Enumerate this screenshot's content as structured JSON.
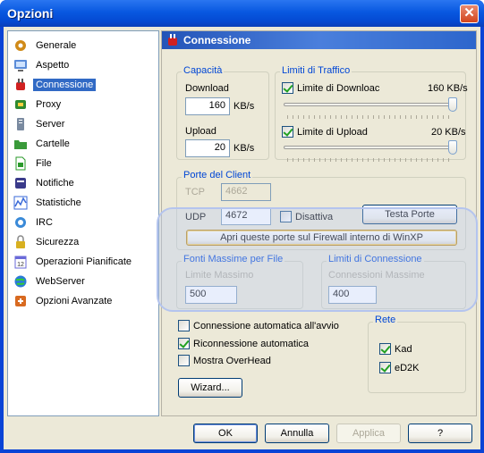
{
  "window": {
    "title": "Opzioni",
    "close_glyph": "✕"
  },
  "sidebar": {
    "items": [
      {
        "label": "Generale",
        "icon": "gear-icon",
        "color": "#d08a18"
      },
      {
        "label": "Aspetto",
        "icon": "monitor-icon",
        "color": "#5b8cd8"
      },
      {
        "label": "Connessione",
        "icon": "plug-icon",
        "color": "#d02020",
        "selected": true
      },
      {
        "label": "Proxy",
        "icon": "proxy-icon",
        "color": "#2f8a2f"
      },
      {
        "label": "Server",
        "icon": "server-icon",
        "color": "#7a8aa0"
      },
      {
        "label": "Cartelle",
        "icon": "folder-icon",
        "color": "#3a9a3a"
      },
      {
        "label": "File",
        "icon": "file-icon",
        "color": "#2a9a2a"
      },
      {
        "label": "Notifiche",
        "icon": "notification-icon",
        "color": "#3a3a8a"
      },
      {
        "label": "Statistiche",
        "icon": "chart-icon",
        "color": "#3a6ad8"
      },
      {
        "label": "IRC",
        "icon": "irc-icon",
        "color": "#3a8ad8"
      },
      {
        "label": "Sicurezza",
        "icon": "lock-icon",
        "color": "#d8b020"
      },
      {
        "label": "Operazioni Pianificate",
        "icon": "calendar-icon",
        "color": "#6a6ad8"
      },
      {
        "label": "WebServer",
        "icon": "globe-icon",
        "color": "#2a7ad8"
      },
      {
        "label": "Opzioni Avanzate",
        "icon": "advanced-icon",
        "color": "#d86a20"
      }
    ]
  },
  "panel": {
    "title": "Connessione",
    "capacita": {
      "title": "Capacità",
      "download_label": "Download",
      "download_value": "160",
      "download_unit": "KB/s",
      "upload_label": "Upload",
      "upload_value": "20",
      "upload_unit": "KB/s"
    },
    "limiti": {
      "title": "Limiti di Traffico",
      "download_check": "Limite di Downloac",
      "download_checked": true,
      "download_value": "160 KB/s",
      "download_level": 1.0,
      "upload_check": "Limite di Upload",
      "upload_checked": true,
      "upload_value": "20 KB/s",
      "upload_level": 1.0
    },
    "porte": {
      "title": "Porte del Client",
      "tcp_label": "TCP",
      "tcp_value": "4662",
      "udp_label": "UDP",
      "udp_value": "4672",
      "disattiva_label": "Disattiva",
      "disattiva_checked": false,
      "testa_label": "Testa Porte",
      "firewall_label": "Apri queste porte sul Firewall interno di WinXP"
    },
    "fonti": {
      "title": "Fonti Massime per File",
      "limite_label": "Limite Massimo",
      "value": "500"
    },
    "conn": {
      "title": "Limiti di Connessione",
      "max_label": "Connessioni Massime",
      "value": "400"
    },
    "options": {
      "auto_label": "Connessione automatica all'avvio",
      "auto_checked": false,
      "reconn_label": "Riconnessione automatica",
      "reconn_checked": true,
      "overhead_label": "Mostra OverHead",
      "overhead_checked": false
    },
    "rete": {
      "title": "Rete",
      "kad_label": "Kad",
      "kad_checked": true,
      "ed2k_label": "eD2K",
      "ed2k_checked": true
    },
    "wizard_label": "Wizard..."
  },
  "footer": {
    "ok": "OK",
    "annulla": "Annulla",
    "applica": "Applica",
    "help": "?"
  }
}
